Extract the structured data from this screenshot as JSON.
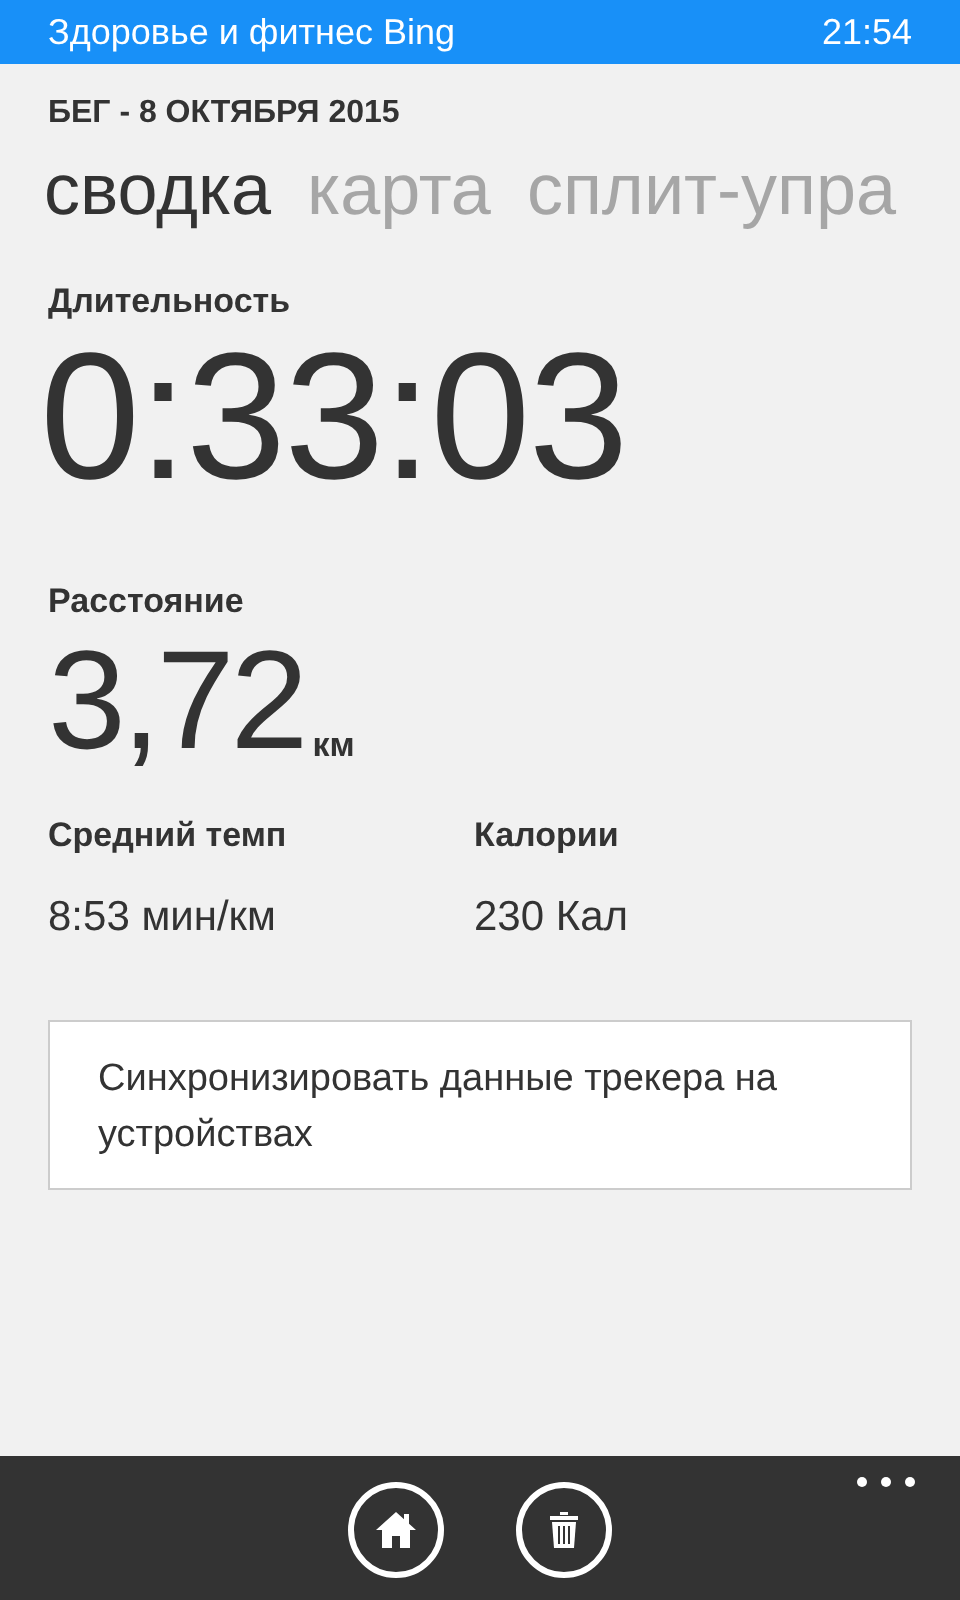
{
  "status_bar": {
    "app_title": "Здоровье и фитнес Bing",
    "time": "21:54"
  },
  "header": "БЕГ - 8 ОКТЯБРЯ 2015",
  "tabs": [
    {
      "label": "сводка",
      "selected": true
    },
    {
      "label": "карта",
      "selected": false
    },
    {
      "label": "сплит-упра",
      "selected": false
    }
  ],
  "duration": {
    "label": "Длительность",
    "value": "0:33:03"
  },
  "distance": {
    "label": "Расстояние",
    "value": "3,72",
    "unit": "км"
  },
  "stats": [
    {
      "label": "Средний темп",
      "value": "8:53 мин/км"
    },
    {
      "label": "Калории",
      "value": "230 Кал"
    }
  ],
  "sync_button": "Синхронизировать данные трекера на устройствах",
  "app_bar": {
    "buttons": [
      {
        "kind": "home"
      },
      {
        "kind": "delete"
      }
    ]
  }
}
